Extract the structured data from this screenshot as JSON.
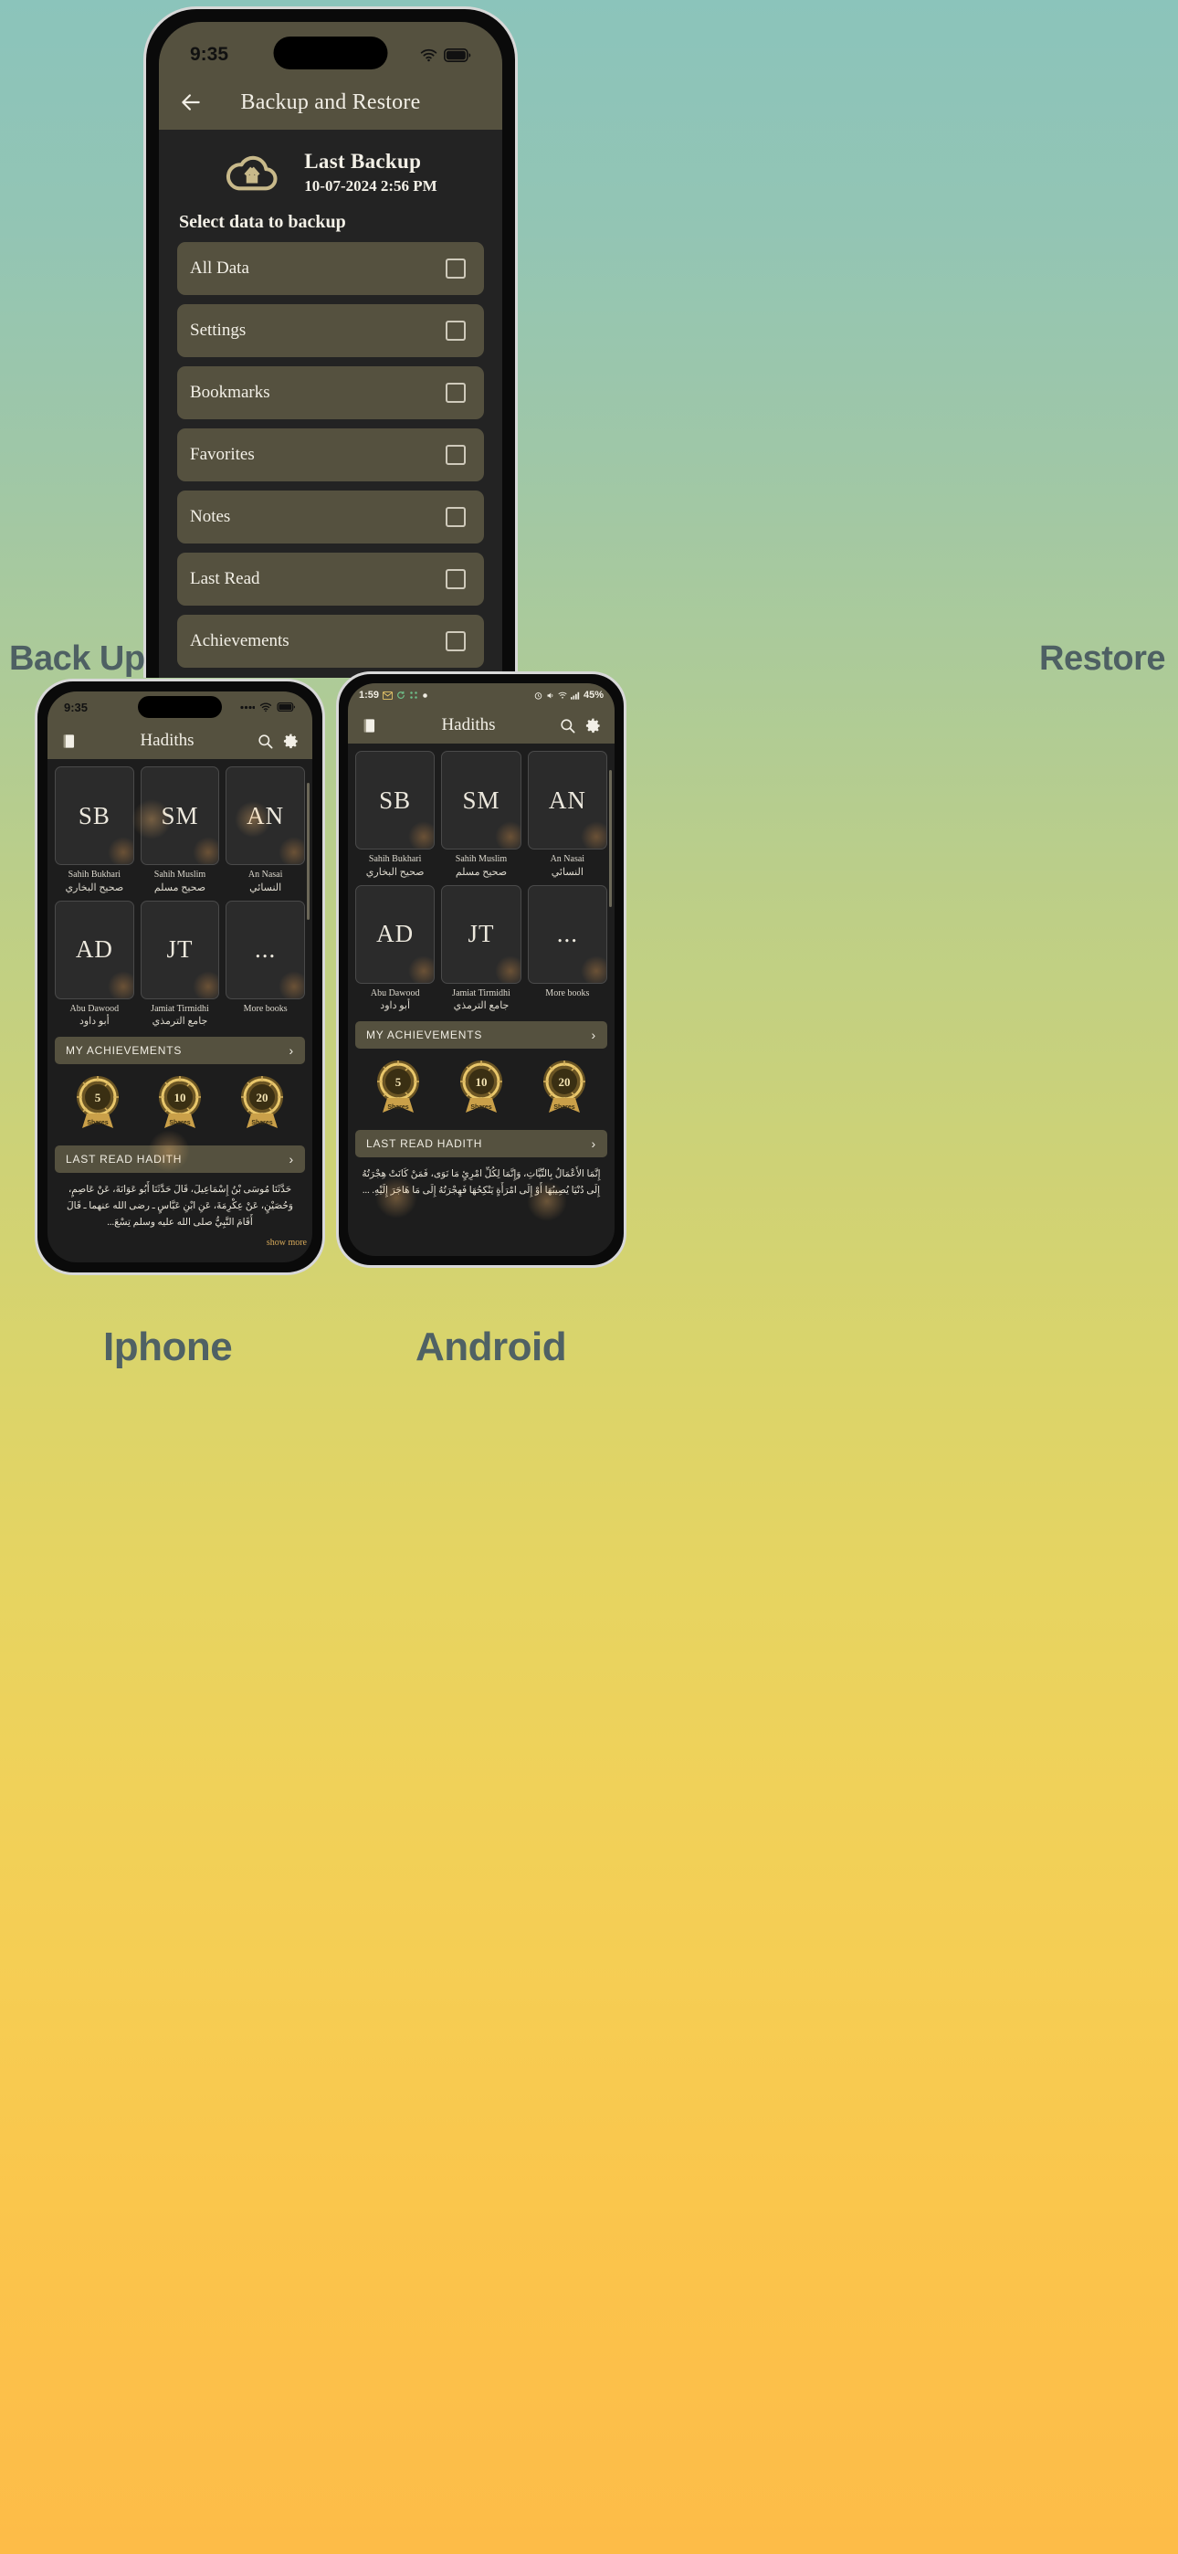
{
  "poster": {
    "label_backup": "Back Up",
    "label_restore": "Restore",
    "label_iphone": "Iphone",
    "label_android": "Android",
    "accent_olive": "#55513f",
    "accent_gold": "#c8b98a",
    "bg_top": "#8bc4bb",
    "bg_bottom": "#fdbc48"
  },
  "backup_screen": {
    "status": {
      "time": "9:35",
      "wifi_icon": "wifi-icon",
      "battery_icon": "battery-icon"
    },
    "appbar": {
      "back_icon": "back-arrow-icon",
      "title": "Backup and Restore"
    },
    "cloud_icon": "cloud-upload-icon",
    "last_backup_title": "Last Backup",
    "last_backup_date": "10-07-2024 2:56 PM",
    "select_label": "Select data to backup",
    "items": [
      {
        "label": "All Data",
        "checked": false
      },
      {
        "label": "Settings",
        "checked": false
      },
      {
        "label": "Bookmarks",
        "checked": false
      },
      {
        "label": "Favorites",
        "checked": false
      },
      {
        "label": "Notes",
        "checked": false
      },
      {
        "label": "Last Read",
        "checked": false
      },
      {
        "label": "Achievements",
        "checked": false
      }
    ]
  },
  "iphone_screen": {
    "status": {
      "time": "9:35",
      "signal_icon": "signal-dots-icon",
      "wifi_icon": "wifi-icon",
      "battery_icon": "battery-icon"
    },
    "appbar": {
      "menu_icon": "book-icon",
      "title": "Hadiths",
      "search_icon": "search-icon",
      "settings_icon": "gear-icon"
    },
    "books": [
      {
        "abbr": "SB",
        "name": "Sahih Bukhari",
        "arabic": "صحيح البخاري"
      },
      {
        "abbr": "SM",
        "name": "Sahih Muslim",
        "arabic": "صحيح مسلم"
      },
      {
        "abbr": "AN",
        "name": "An Nasai",
        "arabic": "النسائي"
      },
      {
        "abbr": "AD",
        "name": "Abu Dawood",
        "arabic": "أبو داود"
      },
      {
        "abbr": "JT",
        "name": "Jamiat Tirmidhi",
        "arabic": "جامع الترمذي"
      },
      {
        "abbr": "...",
        "name": "More books",
        "arabic": ""
      }
    ],
    "achievements_bar": "MY ACHIEVEMENTS",
    "badges": [
      {
        "num": "5",
        "label": "Shares"
      },
      {
        "num": "10",
        "label": "Shares"
      },
      {
        "num": "20",
        "label": "Shares"
      }
    ],
    "last_read_bar": "LAST READ HADITH",
    "hadith_text": "حَدَّثَنَا مُوسَى بْنُ إِسْمَاعِيلَ، قَالَ حَدَّثَنَا أَبُو عَوَانَةَ، عَنْ عَاصِمٍ، وَحُصَيْنٍ، عَنْ عِكْرِمَةَ، عَنِ ابْنِ عَبَّاسٍ ـ رضى الله عنهما ـ قَالَ أَقَامَ النَّبِيُّ صلى الله عليه وسلم تِسْعَ...",
    "show_more": "show more"
  },
  "android_screen": {
    "status": {
      "time": "1:59",
      "left_icons": [
        "gmail-icon",
        "sync-icon",
        "apps-icon",
        "dot-icon"
      ],
      "right_icons": [
        "alarm-icon",
        "volume-icon",
        "wifi-icon",
        "signal-icon"
      ],
      "battery": "45%"
    },
    "appbar": {
      "menu_icon": "book-icon",
      "title": "Hadiths",
      "search_icon": "search-icon",
      "settings_icon": "gear-icon"
    },
    "books": [
      {
        "abbr": "SB",
        "name": "Sahih Bukhari",
        "arabic": "صحيح البخاري"
      },
      {
        "abbr": "SM",
        "name": "Sahih Muslim",
        "arabic": "صحيح مسلم"
      },
      {
        "abbr": "AN",
        "name": "An Nasai",
        "arabic": "النسائي"
      },
      {
        "abbr": "AD",
        "name": "Abu Dawood",
        "arabic": "أبو داود"
      },
      {
        "abbr": "JT",
        "name": "Jamiat Tirmidhi",
        "arabic": "جامع الترمذي"
      },
      {
        "abbr": "...",
        "name": "More books",
        "arabic": ""
      }
    ],
    "achievements_bar": "MY ACHIEVEMENTS",
    "badges": [
      {
        "num": "5",
        "label": "Shares"
      },
      {
        "num": "10",
        "label": "Shares"
      },
      {
        "num": "20",
        "label": "Shares"
      }
    ],
    "last_read_bar": "LAST READ HADITH",
    "hadith_text": "إِنَّمَا الأَعْمَالُ بِالنِّيَّاتِ، وَإِنَّمَا لِكُلِّ امْرِئٍ مَا نَوَى، فَمَنْ كَانَتْ هِجْرَتُهُ إِلَى دُنْيَا يُصِيبُهَا أَوْ إِلَى امْرَأَةٍ يَنْكِحُهَا فَهِجْرَتُهُ إِلَى مَا هَاجَرَ إِلَيْهِ. ...",
    "show_more": ""
  }
}
